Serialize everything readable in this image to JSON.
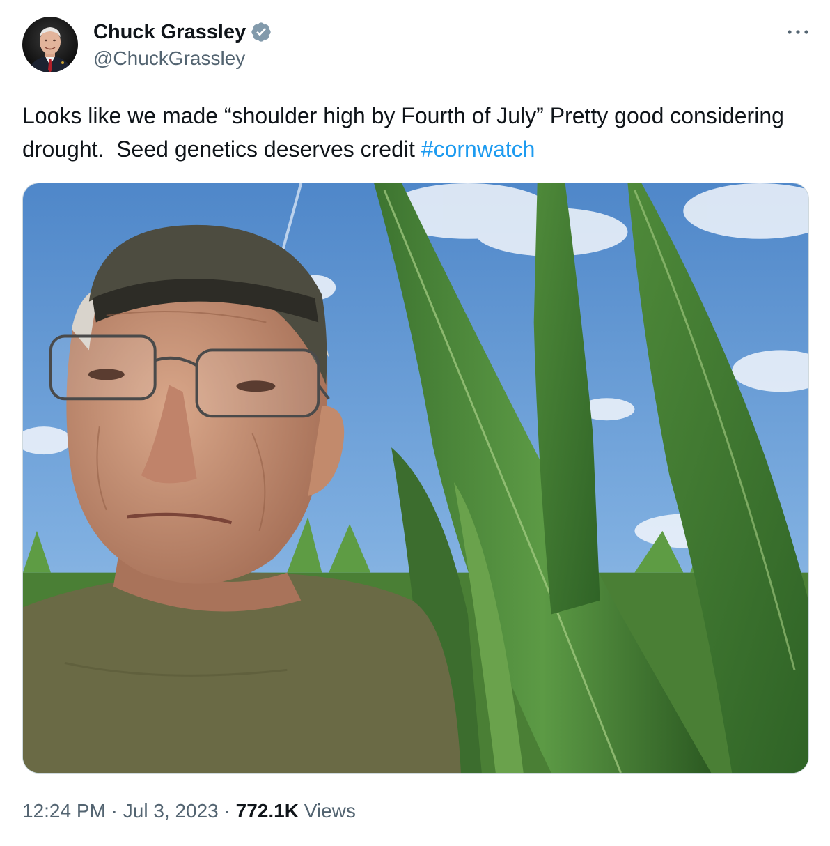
{
  "author": {
    "display_name": "Chuck Grassley",
    "handle": "@ChuckGrassley",
    "verified_icon": "verified-badge-icon",
    "verified_color": "#829aab"
  },
  "tweet": {
    "text_before": "Looks like we made “shoulder high by Fourth of July” Pretty good considering drought.  Seed genetics deserves credit ",
    "hashtag": "#cornwatch",
    "hashtag_color": "#1d9bf0"
  },
  "media": {
    "type": "photo",
    "alt_icon": "photo"
  },
  "meta": {
    "time": "12:24 PM",
    "separator": "·",
    "date": "Jul 3, 2023",
    "views_count": "772.1K",
    "views_label": "Views"
  },
  "menu": {
    "icon": "more-horizontal-icon"
  },
  "colors": {
    "text_primary": "#0f1419",
    "text_secondary": "#536471",
    "link": "#1d9bf0",
    "border": "#cfd9de"
  }
}
